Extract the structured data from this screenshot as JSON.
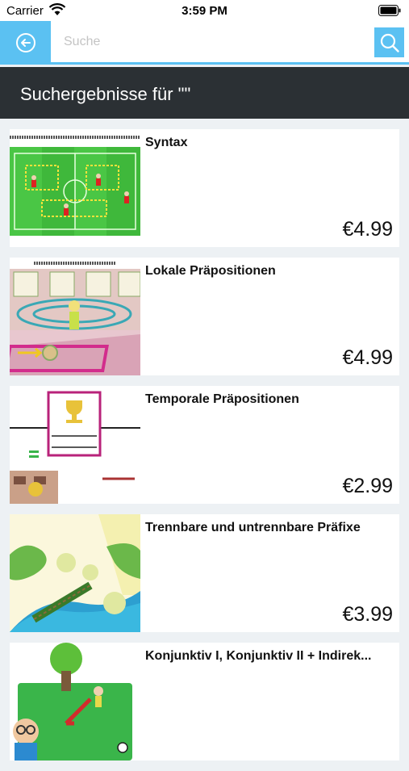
{
  "status": {
    "carrier": "Carrier",
    "time": "3:59 PM",
    "icons": [
      "wifi-icon",
      "battery-icon"
    ]
  },
  "search": {
    "placeholder": "Suche",
    "value": "",
    "back_icon": "back-arrow-icon",
    "search_icon": "search-icon"
  },
  "header": {
    "title": "Suchergebnisse für \"\""
  },
  "results": [
    {
      "title": "Syntax",
      "price": "€4.99"
    },
    {
      "title": "Lokale Präpositionen",
      "price": "€4.99"
    },
    {
      "title": "Temporale Präpositionen",
      "price": "€2.99"
    },
    {
      "title": "Trennbare und untrennbare Präfixe",
      "price": "€3.99"
    },
    {
      "title": "Konjunktiv I, Konjunktiv II + Indirek...",
      "price": ""
    }
  ],
  "colors": {
    "accent": "#5bc1f2",
    "header_bg": "#2b3034",
    "page_bg": "#edf1f4"
  }
}
